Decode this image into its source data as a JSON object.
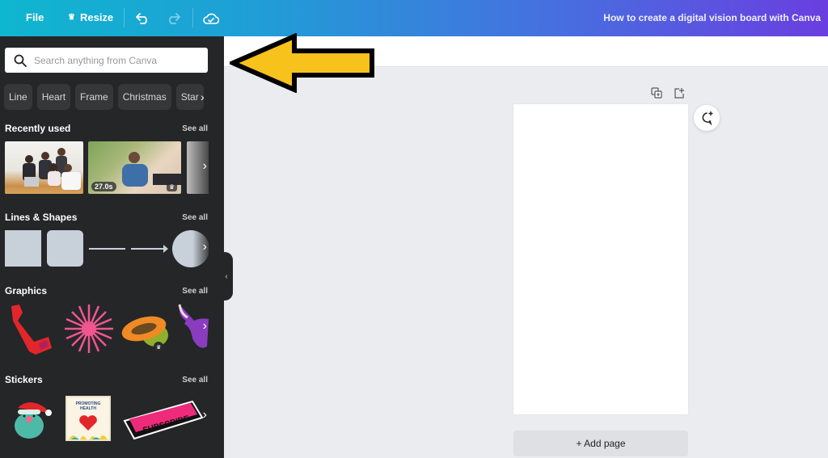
{
  "topbar": {
    "file_label": "File",
    "resize_label": "Resize",
    "title": "How to create a digital vision board with Canva",
    "icons": [
      "undo-icon",
      "redo-icon",
      "cloud-saved-icon",
      "crown-icon"
    ]
  },
  "sidebar": {
    "search": {
      "placeholder": "Search anything from Canva",
      "value": ""
    },
    "chips": [
      "Line",
      "Heart",
      "Frame",
      "Christmas",
      "Star"
    ],
    "sections": {
      "recent": {
        "title": "Recently used",
        "see_all": "See all",
        "video_duration": "27.0s"
      },
      "shapes": {
        "title": "Lines & Shapes",
        "see_all": "See all"
      },
      "graphics": {
        "title": "Graphics",
        "see_all": "See all"
      },
      "stickers": {
        "title": "Stickers",
        "see_all": "See all",
        "sticker_texts": [
          "PROMOTING HEALTH",
          "SUBSCRIBE"
        ]
      }
    }
  },
  "canvas": {
    "add_page_label": "+ Add page"
  },
  "colors": {
    "accent_arrow": "#f7c21b",
    "sidebar_bg": "#252627",
    "canvas_bg": "#ebecf0"
  }
}
